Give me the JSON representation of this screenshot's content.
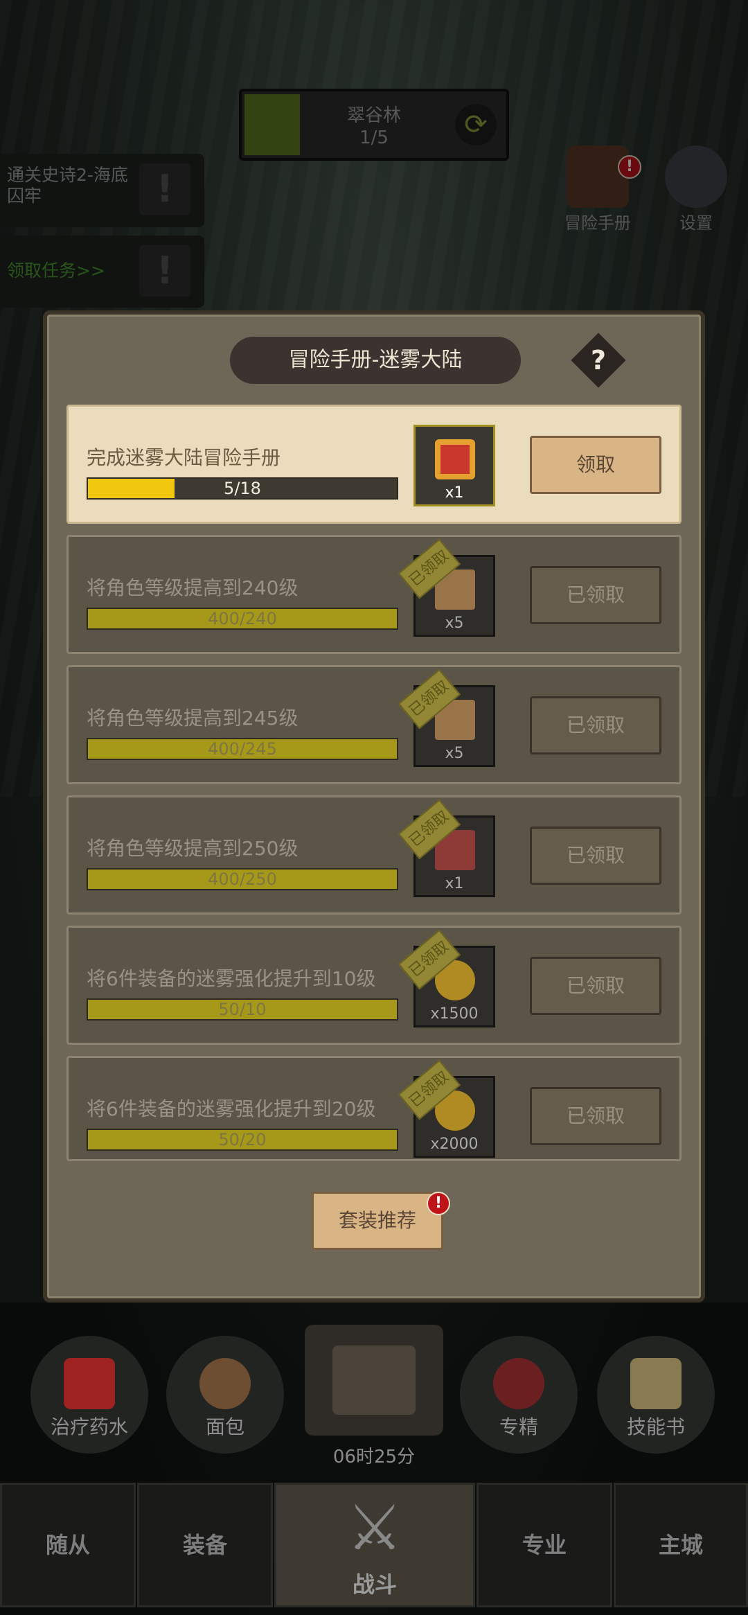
{
  "stage": {
    "name": "翠谷林",
    "progress": "1/5"
  },
  "quests": [
    {
      "text": "通关史诗2-海底囚牢"
    },
    {
      "text": "领取任务>>"
    }
  ],
  "side_icons": [
    {
      "label": "冒险手册",
      "icon": "book-globe-icon"
    },
    {
      "label": "设置",
      "icon": "gear-icon"
    }
  ],
  "dialog": {
    "title": "冒险手册-迷雾大陆",
    "help": "?",
    "items": [
      {
        "label": "完成迷雾大陆冒险手册",
        "progress_text": "5/18",
        "progress": 0.28,
        "reward_count": "x1",
        "reward_icon": "gem-book-icon",
        "button": "领取",
        "claimed": false
      },
      {
        "label": "将角色等级提高到240级",
        "progress_text": "400/240",
        "progress": 1,
        "reward_count": "x5",
        "reward_icon": "scroll-icon",
        "button": "已领取",
        "claimed": true,
        "stamp": "已领取"
      },
      {
        "label": "将角色等级提高到245级",
        "progress_text": "400/245",
        "progress": 1,
        "reward_count": "x5",
        "reward_icon": "scroll-icon",
        "button": "已领取",
        "claimed": true,
        "stamp": "已领取"
      },
      {
        "label": "将角色等级提高到250级",
        "progress_text": "400/250",
        "progress": 1,
        "reward_count": "x1",
        "reward_icon": "red-cloth-icon",
        "button": "已领取",
        "claimed": true,
        "stamp": "已领取"
      },
      {
        "label": "将6件装备的迷雾强化提升到10级",
        "progress_text": "50/10",
        "progress": 1,
        "reward_count": "x1500",
        "reward_icon": "gold-coin-icon",
        "button": "已领取",
        "claimed": true,
        "stamp": "已领取"
      },
      {
        "label": "将6件装备的迷雾强化提升到20级",
        "progress_text": "50/20",
        "progress": 1,
        "reward_count": "x2000",
        "reward_icon": "gold-coin-icon",
        "button": "已领取",
        "claimed": true,
        "stamp": "已领取"
      }
    ],
    "suit_button": "套装推荐"
  },
  "consumables": [
    {
      "label": "治疗药水",
      "icon": "potion-icon"
    },
    {
      "label": "面包",
      "icon": "bread-icon"
    },
    {
      "label": "专精",
      "icon": "spiral-icon"
    },
    {
      "label": "技能书",
      "icon": "skill-book-icon"
    }
  ],
  "chest_timer": "06时25分",
  "nav": [
    {
      "label": "随从"
    },
    {
      "label": "装备"
    },
    {
      "label": "战斗"
    },
    {
      "label": "专业"
    },
    {
      "label": "主城"
    }
  ],
  "colors": {
    "dialog_bg": "#6e6656",
    "progress_active": "#f1c70f",
    "progress_done": "#a69818",
    "badge": "#c0141b"
  }
}
